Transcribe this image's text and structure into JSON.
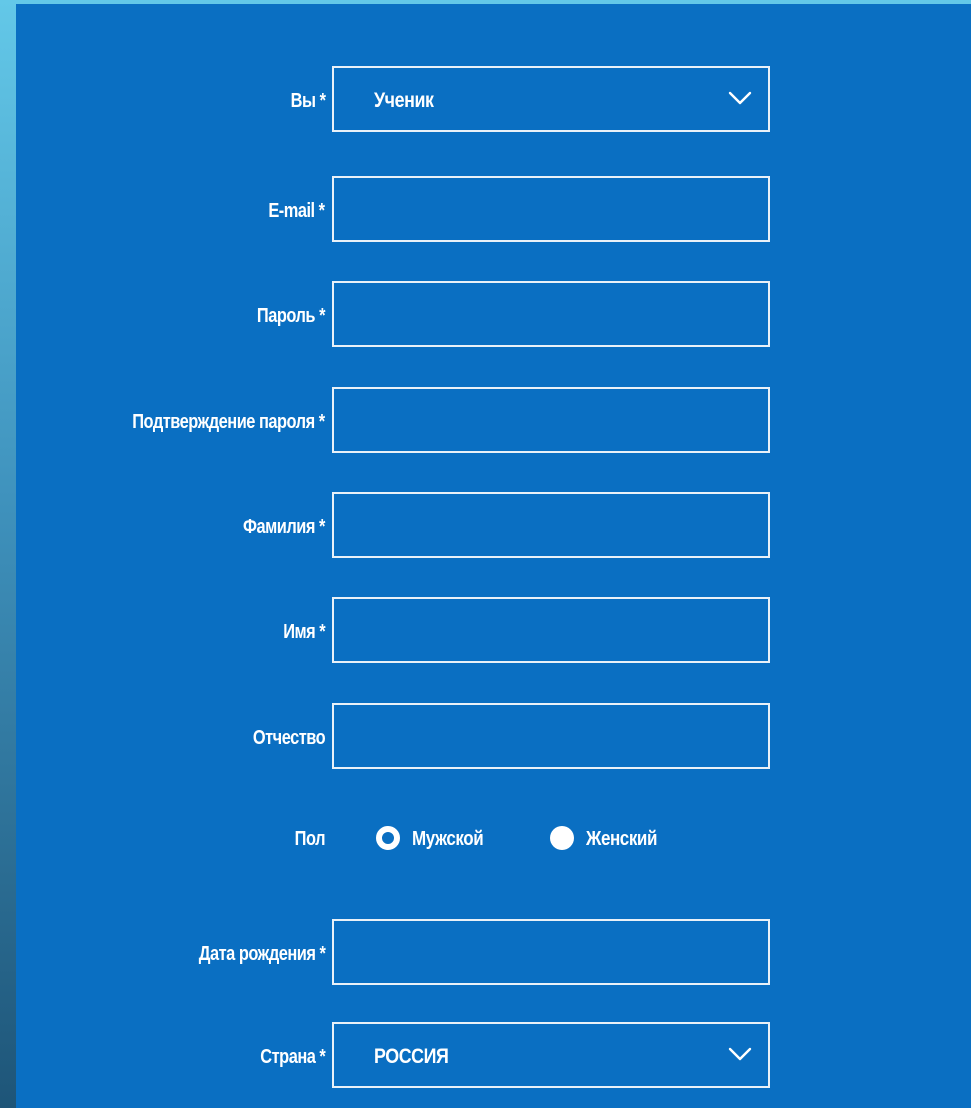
{
  "form": {
    "role": {
      "label": "Вы *",
      "value": "Ученик"
    },
    "email": {
      "label": "E-mail *",
      "value": ""
    },
    "password": {
      "label": "Пароль *",
      "value": ""
    },
    "password_confirm": {
      "label": "Подтверждение пароля *",
      "value": ""
    },
    "last_name": {
      "label": "Фамилия *",
      "value": ""
    },
    "first_name": {
      "label": "Имя *",
      "value": ""
    },
    "patronymic": {
      "label": "Отчество",
      "value": ""
    },
    "gender": {
      "label": "Пол",
      "options": [
        "Мужской",
        "Женский"
      ],
      "selected": "Мужской"
    },
    "birth_date": {
      "label": "Дата рождения *",
      "value": ""
    },
    "country": {
      "label": "Страна *",
      "value": "РОССИЯ"
    }
  },
  "colors": {
    "panel": "#0a6fc2",
    "border": "#e9f1f8",
    "text": "#ffffff",
    "background_top": "#63c8e8",
    "background_bottom": "#1e5578"
  },
  "icons": {
    "select_arrow": "chevron-down-icon",
    "radio_selected": "radio-selected-icon",
    "radio_unselected": "radio-unselected-icon"
  }
}
